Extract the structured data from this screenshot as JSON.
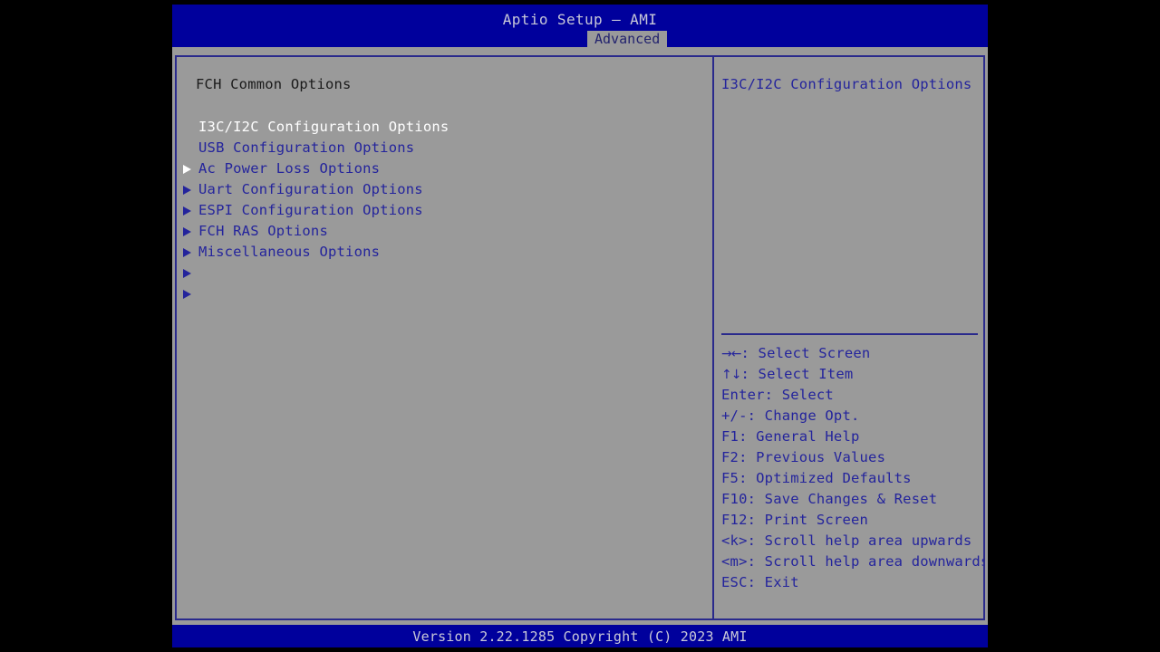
{
  "app": {
    "title": "Aptio Setup – AMI",
    "version_text": "Version 2.22.1285 Copyright (C) 2023 AMI"
  },
  "colors": {
    "header_blue": "#00009c",
    "panel_gray": "#9a9a9a",
    "border_blue": "#2a2a8c",
    "text_blue": "#24249c",
    "selected_white": "#ffffff",
    "title_text": "#c8c8d8"
  },
  "tabs": [
    {
      "label": "Advanced",
      "active": true
    }
  ],
  "left_panel": {
    "title": "FCH Common Options",
    "items": [
      {
        "label": "I3C/I2C Configuration Options",
        "arrow_icon": "triangle-right-icon",
        "selected": true
      },
      {
        "label": "USB Configuration Options",
        "arrow_icon": "triangle-right-icon",
        "selected": false
      },
      {
        "label": "Ac Power Loss Options",
        "arrow_icon": "triangle-right-icon",
        "selected": false
      },
      {
        "label": "Uart Configuration Options",
        "arrow_icon": "triangle-right-icon",
        "selected": false
      },
      {
        "label": "ESPI Configuration Options",
        "arrow_icon": "triangle-right-icon",
        "selected": false
      },
      {
        "label": "FCH RAS Options",
        "arrow_icon": "triangle-right-icon",
        "selected": false
      },
      {
        "label": "Miscellaneous Options",
        "arrow_icon": "triangle-right-icon",
        "selected": false
      }
    ]
  },
  "right_panel": {
    "help_text": "I3C/I2C Configuration Options",
    "legend": [
      {
        "key": "→←",
        "label": ": Select Screen",
        "glyph": true
      },
      {
        "key": "↑↓",
        "label": ": Select Item",
        "glyph": true
      },
      {
        "key": "Enter",
        "label": ": Select",
        "glyph": false
      },
      {
        "key": "+/-",
        "label": ": Change Opt.",
        "glyph": false
      },
      {
        "key": "F1",
        "label": ": General Help",
        "glyph": false
      },
      {
        "key": "F2",
        "label": ": Previous Values",
        "glyph": false
      },
      {
        "key": "F5",
        "label": ": Optimized Defaults",
        "glyph": false
      },
      {
        "key": "F10",
        "label": ": Save Changes & Reset",
        "glyph": false
      },
      {
        "key": "F12",
        "label": ": Print Screen",
        "glyph": false
      },
      {
        "key": "<k>",
        "label": ": Scroll help area upwards",
        "glyph": false
      },
      {
        "key": "<m>",
        "label": ": Scroll help area downwards",
        "glyph": false
      },
      {
        "key": "ESC",
        "label": ": Exit",
        "glyph": false
      }
    ]
  }
}
